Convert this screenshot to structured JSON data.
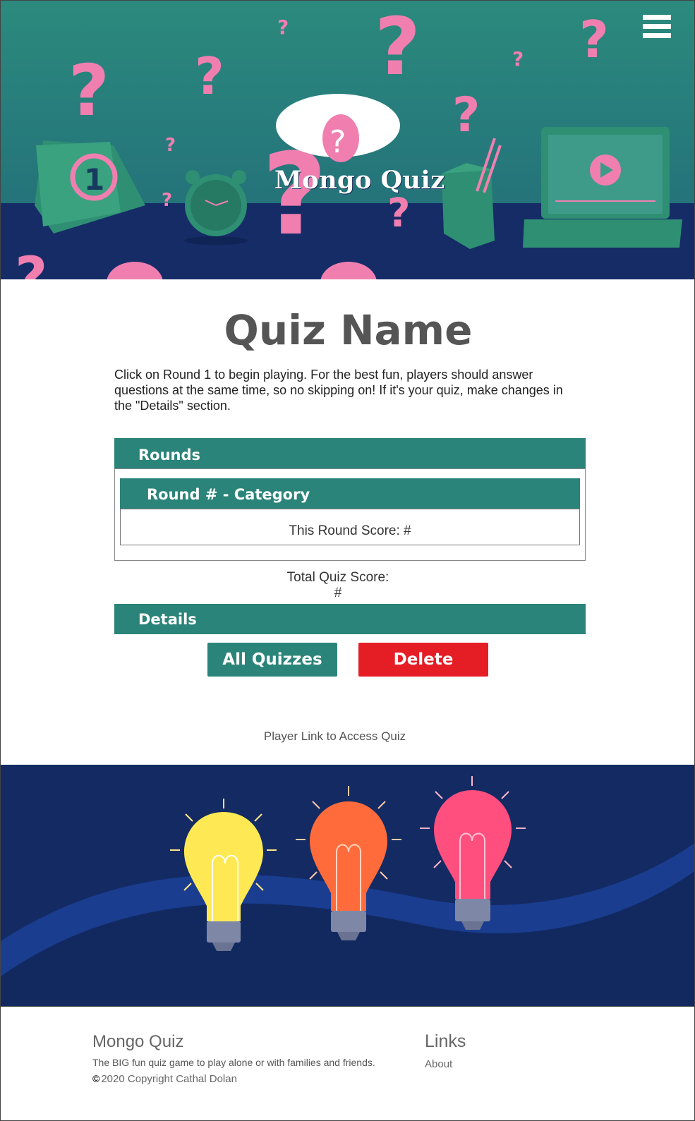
{
  "header": {
    "logo_text": "Mongo Quiz",
    "menu_icon": "hamburger-menu-icon"
  },
  "main": {
    "title": "Quiz Name",
    "intro": "Click on Round 1 to begin playing. For the best fun, players should answer questions at the same time, so no skipping on!  If it's your quiz, make changes in the \"Details\" section.",
    "rounds_header": "Rounds",
    "round": {
      "title": "Round # - Category",
      "score": "This Round Score: #"
    },
    "total_label": "Total Quiz Score:",
    "total_value": "#",
    "details_header": "Details",
    "buttons": {
      "all_quizzes": "All Quizzes",
      "delete": "Delete"
    },
    "player_link": "Player Link to Access Quiz"
  },
  "footer": {
    "brand": "Mongo Quiz",
    "tagline": "The BIG fun quiz game to play alone or with families and friends.",
    "copyright_icon": "©",
    "copyright": "2020 Copyright Cathal Dolan",
    "links_title": "Links",
    "about": "About"
  },
  "colors": {
    "teal": "#2b8479",
    "delete_red": "#e51d25",
    "navy": "#132a63",
    "pink": "#f07fb0"
  }
}
